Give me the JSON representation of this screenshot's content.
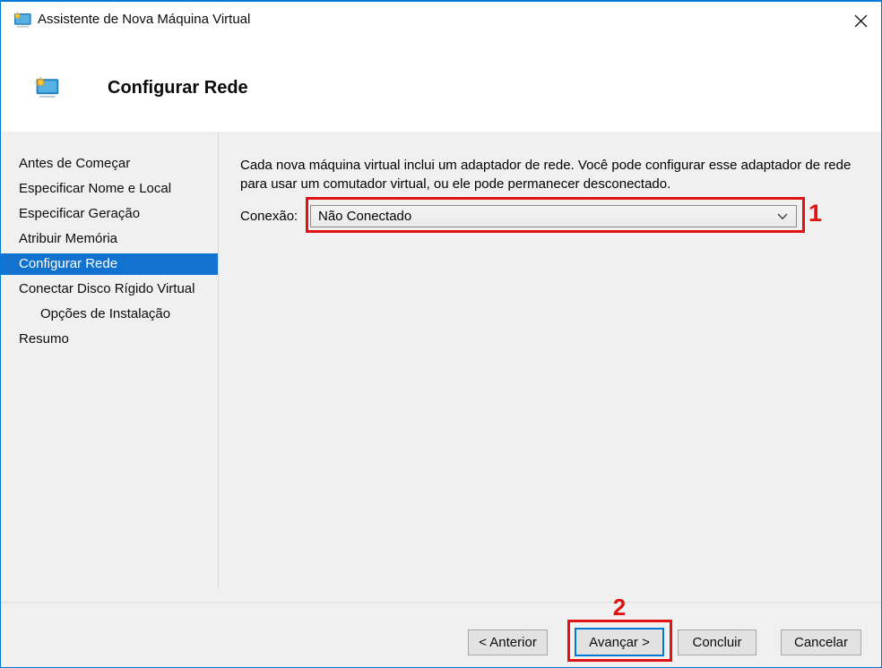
{
  "window": {
    "title": "Assistente de Nova Máquina Virtual"
  },
  "header": {
    "title": "Configurar Rede"
  },
  "sidebar": {
    "items": [
      {
        "label": "Antes de Começar",
        "selected": false,
        "indent": false
      },
      {
        "label": "Especificar Nome e Local",
        "selected": false,
        "indent": false
      },
      {
        "label": "Especificar Geração",
        "selected": false,
        "indent": false
      },
      {
        "label": "Atribuir Memória",
        "selected": false,
        "indent": false
      },
      {
        "label": "Configurar Rede",
        "selected": true,
        "indent": false
      },
      {
        "label": "Conectar Disco Rígido Virtual",
        "selected": false,
        "indent": false
      },
      {
        "label": "Opções de Instalação",
        "selected": false,
        "indent": true
      },
      {
        "label": "Resumo",
        "selected": false,
        "indent": false
      }
    ]
  },
  "main": {
    "description": "Cada nova máquina virtual inclui um adaptador de rede. Você pode configurar esse adaptador de rede para usar um comutador virtual, ou ele pode permanecer desconectado.",
    "connection": {
      "label": "Conexão:",
      "value": "Não Conectado"
    }
  },
  "footer": {
    "back_label": "< Anterior",
    "next_label": "Avançar >",
    "finish_label": "Concluir",
    "cancel_label": "Cancelar"
  },
  "annotations": {
    "step1": "1",
    "step2": "2",
    "highlight_color": "#e01212"
  },
  "icons": {
    "titlebar_icon": "vm-wizard-monitor-star",
    "header_icon": "vm-wizard-monitor-star",
    "close": "close-x",
    "combobox": "chevron-down"
  },
  "colors": {
    "window_border": "#0079d8",
    "selected_item_bg": "#1173cf",
    "body_bg": "#f0f0f0",
    "button_bg": "#e2e2e2",
    "button_border": "#a6a6a6",
    "default_button_border": "#0078d7"
  }
}
